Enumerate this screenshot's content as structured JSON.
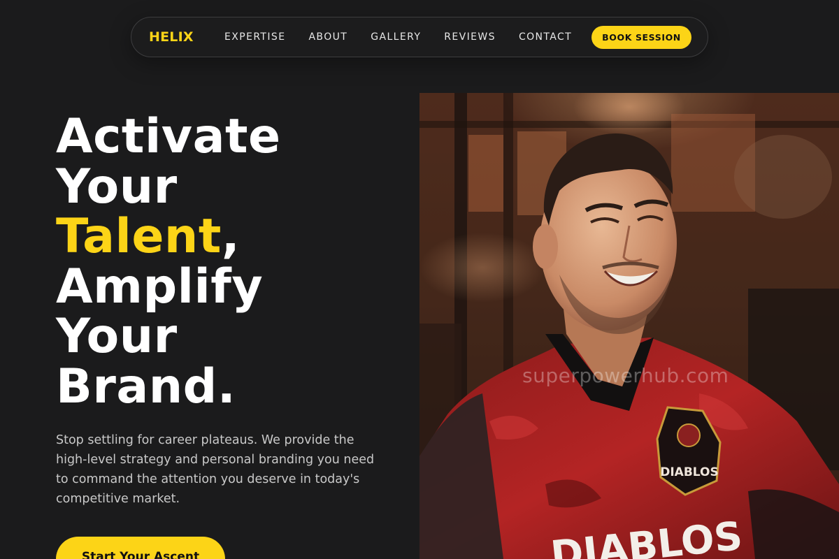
{
  "nav": {
    "brand": "HELIX",
    "links": [
      "EXPERTISE",
      "ABOUT",
      "GALLERY",
      "REVIEWS",
      "CONTACT"
    ],
    "cta_label": "BOOK SESSION"
  },
  "hero": {
    "line1": "Activate",
    "line2": "Your",
    "line3_highlight": "Talent",
    "line3_rest": ",",
    "line4": "Amplify",
    "line5": "Your",
    "line6": "Brand.",
    "description": "Stop settling for career plateaus. We provide the high-level strategy and personal branding you need to command the attention you deserve in today's competitive market.",
    "cta_label": "Start Your Ascent"
  },
  "photo": {
    "watermark": "superpowerhub.com",
    "jersey_logo_text": "DIABLOS",
    "jersey_front_text": "DIABLOS"
  },
  "colors": {
    "background": "#1b1b1c",
    "accent": "#fcd417",
    "text": "#ffffff",
    "muted_text": "#c9c9c9"
  }
}
